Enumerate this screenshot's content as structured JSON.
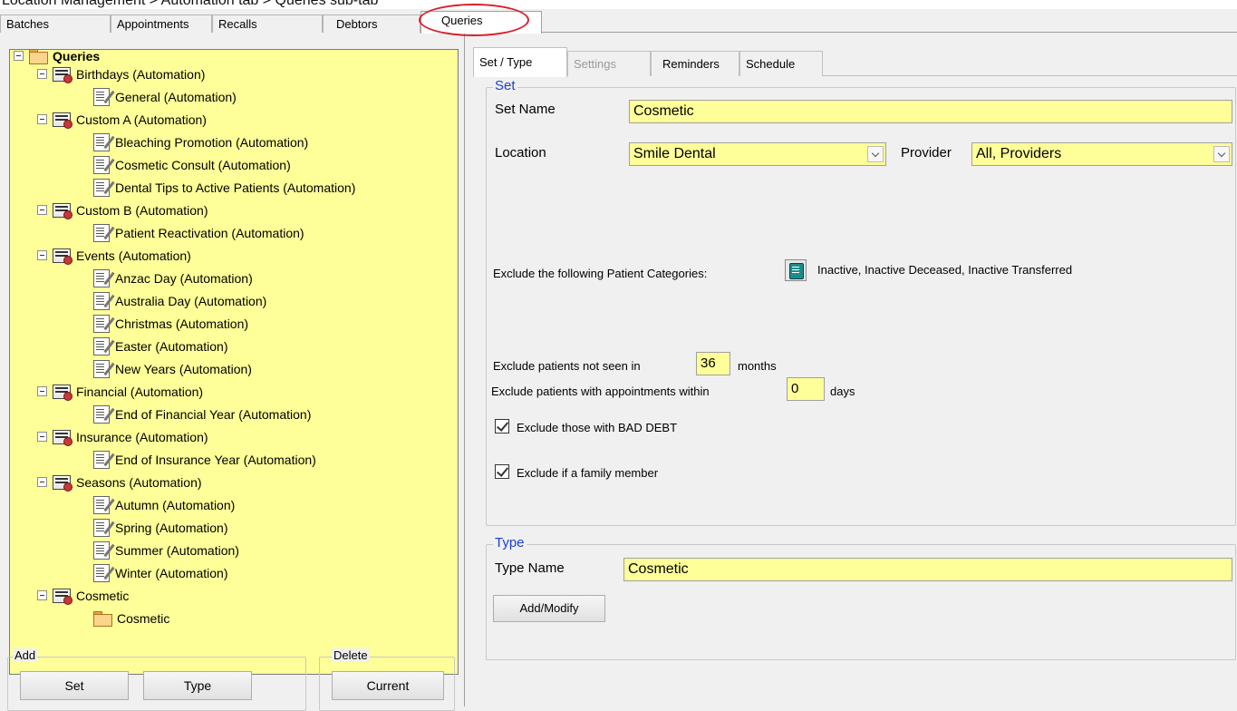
{
  "caption": "Location Management > Automation tab > Queries sub-tab",
  "main_tabs": [
    {
      "label": "Batches"
    },
    {
      "label": "Appointments"
    },
    {
      "label": "Recalls"
    },
    {
      "label": "Debtors"
    },
    {
      "label": "Queries"
    }
  ],
  "tree": {
    "root": "Queries",
    "items": [
      {
        "label": "Birthdays (Automation)"
      },
      {
        "label": "General (Automation)"
      },
      {
        "label": "Custom A (Automation)"
      },
      {
        "label": "Bleaching Promotion (Automation)"
      },
      {
        "label": "Cosmetic Consult (Automation)"
      },
      {
        "label": "Dental Tips to Active Patients (Automation)"
      },
      {
        "label": "Custom B (Automation)"
      },
      {
        "label": "Patient Reactivation (Automation)"
      },
      {
        "label": "Events (Automation)"
      },
      {
        "label": "Anzac Day (Automation)"
      },
      {
        "label": "Australia Day (Automation)"
      },
      {
        "label": "Christmas (Automation)"
      },
      {
        "label": "Easter (Automation)"
      },
      {
        "label": "New Years (Automation)"
      },
      {
        "label": "Financial (Automation)"
      },
      {
        "label": "End of Financial Year (Automation)"
      },
      {
        "label": "Insurance (Automation)"
      },
      {
        "label": "End of Insurance Year (Automation)"
      },
      {
        "label": "Seasons (Automation)"
      },
      {
        "label": "Autumn (Automation)"
      },
      {
        "label": "Spring (Automation)"
      },
      {
        "label": "Summer (Automation)"
      },
      {
        "label": "Winter (Automation)"
      },
      {
        "label": "Cosmetic"
      },
      {
        "label": "Cosmetic"
      }
    ]
  },
  "add_group": {
    "label": "Add",
    "set_button": "Set",
    "type_button": "Type"
  },
  "delete_group": {
    "label": "Delete",
    "current_button": "Current"
  },
  "sub_tabs": [
    {
      "label": "Set / Type"
    },
    {
      "label": "Settings"
    },
    {
      "label": "Reminders"
    },
    {
      "label": "Schedule"
    }
  ],
  "set_section": {
    "title": "Set",
    "set_name_label": "Set Name",
    "set_name_value": "Cosmetic",
    "location_label": "Location",
    "location_value": "Smile Dental",
    "provider_label": "Provider",
    "provider_value": "All,  Providers",
    "exclude_categories_label": "Exclude the following Patient Categories:",
    "exclude_categories_value": "Inactive, Inactive Deceased, Inactive Transferred",
    "not_seen_prefix": "Exclude patients not seen in",
    "not_seen_value": "36",
    "not_seen_suffix": "months",
    "appt_within_prefix": "Exclude patients with appointments within",
    "appt_within_value": "0",
    "appt_within_suffix": "days",
    "bad_debt_label": "Exclude those with BAD DEBT",
    "bad_debt_checked": true,
    "family_label": "Exclude if a family member",
    "family_checked": true
  },
  "type_section": {
    "title": "Type",
    "type_name_label": "Type Name",
    "type_name_value": "Cosmetic",
    "add_modify_button": "Add/Modify"
  }
}
